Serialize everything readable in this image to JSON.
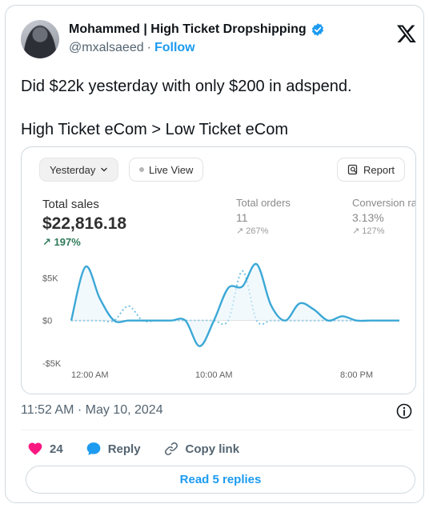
{
  "author": {
    "display_name": "Mohammed | High Ticket Dropshipping",
    "handle": "@mxalsaeed",
    "separator": "·",
    "follow_label": "Follow"
  },
  "tweet": {
    "line1": "Did $22k yesterday with only $200 in adspend.",
    "line2": "High Ticket eCom > Low Ticket eCom",
    "timestamp": "11:52 AM · May 10, 2024"
  },
  "dashboard": {
    "range_label": "Yesterday",
    "live_label": "Live View",
    "report_label": "Report",
    "metrics": [
      {
        "label": "Total sales",
        "value": "$22,816.18",
        "change": "↗ 197%"
      },
      {
        "label": "Total orders",
        "value": "11",
        "change": "↗ 267%"
      },
      {
        "label": "Conversion ra",
        "value": "3.13%",
        "change": "↗ 127%"
      }
    ]
  },
  "chart_data": {
    "type": "line",
    "x_tick_labels": [
      "12:00 AM",
      "10:00 AM",
      "8:00 PM"
    ],
    "y_tick_labels": [
      "$5K",
      "$0",
      "-$5K"
    ],
    "ylim": [
      -5000,
      7000
    ],
    "x": [
      0,
      1,
      2,
      3,
      4,
      5,
      6,
      7,
      8,
      9,
      10,
      11,
      12,
      13,
      14,
      15,
      16,
      17,
      18,
      19,
      20,
      21,
      22,
      23
    ],
    "series": [
      {
        "values": [
          0,
          6300,
          2600,
          0,
          0,
          0,
          0,
          0,
          0,
          -3000,
          0,
          3800,
          4000,
          6600,
          1800,
          0,
          2000,
          1300,
          0,
          500,
          0,
          0,
          0,
          0
        ],
        "style": "solid"
      },
      {
        "values": [
          0,
          0,
          0,
          0,
          1700,
          0,
          0,
          0,
          0,
          0,
          0,
          0,
          5800,
          0,
          0,
          0,
          0,
          0,
          0,
          0,
          0,
          0,
          0,
          0
        ],
        "style": "dotted"
      }
    ],
    "colors": {
      "line": "#3ba8d6",
      "zero_line": "#d9d9d9",
      "area": "#e9f5fb"
    }
  },
  "actions": {
    "like_count": "24",
    "reply_label": "Reply",
    "copy_link_label": "Copy link",
    "read_replies_label": "Read 5 replies"
  },
  "colors": {
    "accent": "#1d9bf0",
    "heart": "#f91880",
    "positive_change": "#2f7a59"
  },
  "icons": [
    "verified-badge-icon",
    "x-logo-icon",
    "chevron-down-icon",
    "report-icon",
    "info-icon",
    "heart-icon",
    "reply-icon",
    "link-icon"
  ]
}
